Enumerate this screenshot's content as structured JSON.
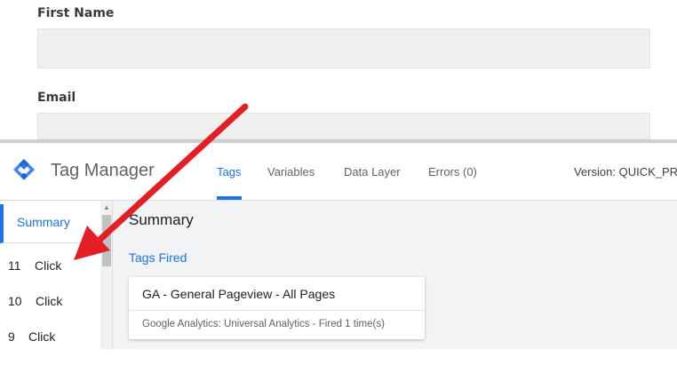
{
  "form": {
    "first_name_label": "First Name",
    "first_name_value": "",
    "email_label": "Email",
    "email_value": ""
  },
  "header": {
    "app_title": "Tag Manager",
    "tabs": [
      {
        "label": "Tags",
        "active": true
      },
      {
        "label": "Variables",
        "active": false
      },
      {
        "label": "Data Layer",
        "active": false
      },
      {
        "label": "Errors (0)",
        "active": false
      }
    ],
    "version_text": "Version: QUICK_PRI"
  },
  "sidebar": {
    "summary_label": "Summary",
    "items": [
      {
        "num": "11",
        "label": "Click"
      },
      {
        "num": "10",
        "label": "Click"
      },
      {
        "num": "9",
        "label": "Click"
      }
    ]
  },
  "main": {
    "title": "Summary",
    "section_title": "Tags Fired",
    "card": {
      "title": "GA - General Pageview - All Pages",
      "subtitle": "Google Analytics: Universal Analytics - Fired 1 time(s)"
    }
  },
  "colors": {
    "accent": "#1a73e8",
    "arrow": "#e31e24",
    "logo_blue": "#4285f4",
    "logo_dark": "#1967d2"
  },
  "icons": [
    "tag-manager-logo-icon",
    "scroll-up-icon",
    "red-arrow-annotation"
  ]
}
